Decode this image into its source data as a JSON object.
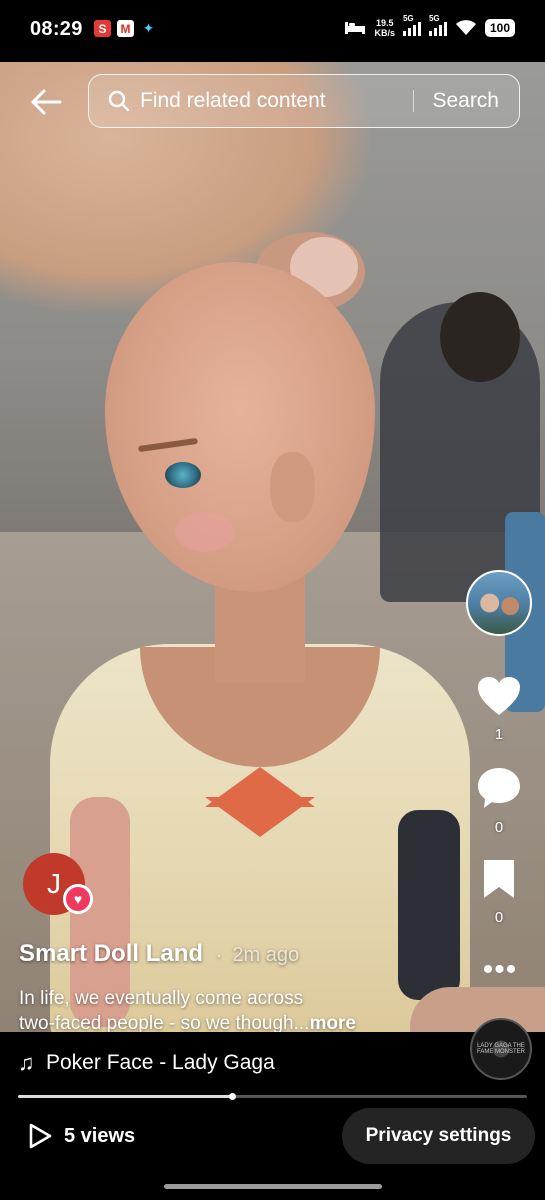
{
  "status_bar": {
    "time": "08:29",
    "notification_icons": [
      "shopee-icon",
      "gmail-icon",
      "game-icon"
    ],
    "speed_value": "19.5",
    "speed_unit": "KB/s",
    "signal1_label": "5G",
    "signal2_label": "5G",
    "battery": "100"
  },
  "search": {
    "placeholder": "Find related content",
    "button_label": "Search"
  },
  "rail": {
    "likes": "1",
    "comments": "0",
    "saves": "0"
  },
  "author": {
    "initial": "J",
    "name": "Smart Doll Land",
    "separator": "·",
    "time_ago": "2m ago"
  },
  "caption": {
    "line1": "In life, we eventually come across",
    "line2": "two-faced people - so we though...",
    "more": "more"
  },
  "music": {
    "title": "Poker Face - Lady Gaga",
    "disc_text": "LADY GAGA THE FAME MONSTER"
  },
  "progress": {
    "fraction": 0.42
  },
  "footer": {
    "views": "5 views",
    "privacy_label": "Privacy settings"
  },
  "colors": {
    "like_icon": "#ffffff",
    "follow_badge": "#ef3a5d",
    "author_avatar": "#c0392b",
    "privacy_button_bg": "#242424"
  }
}
